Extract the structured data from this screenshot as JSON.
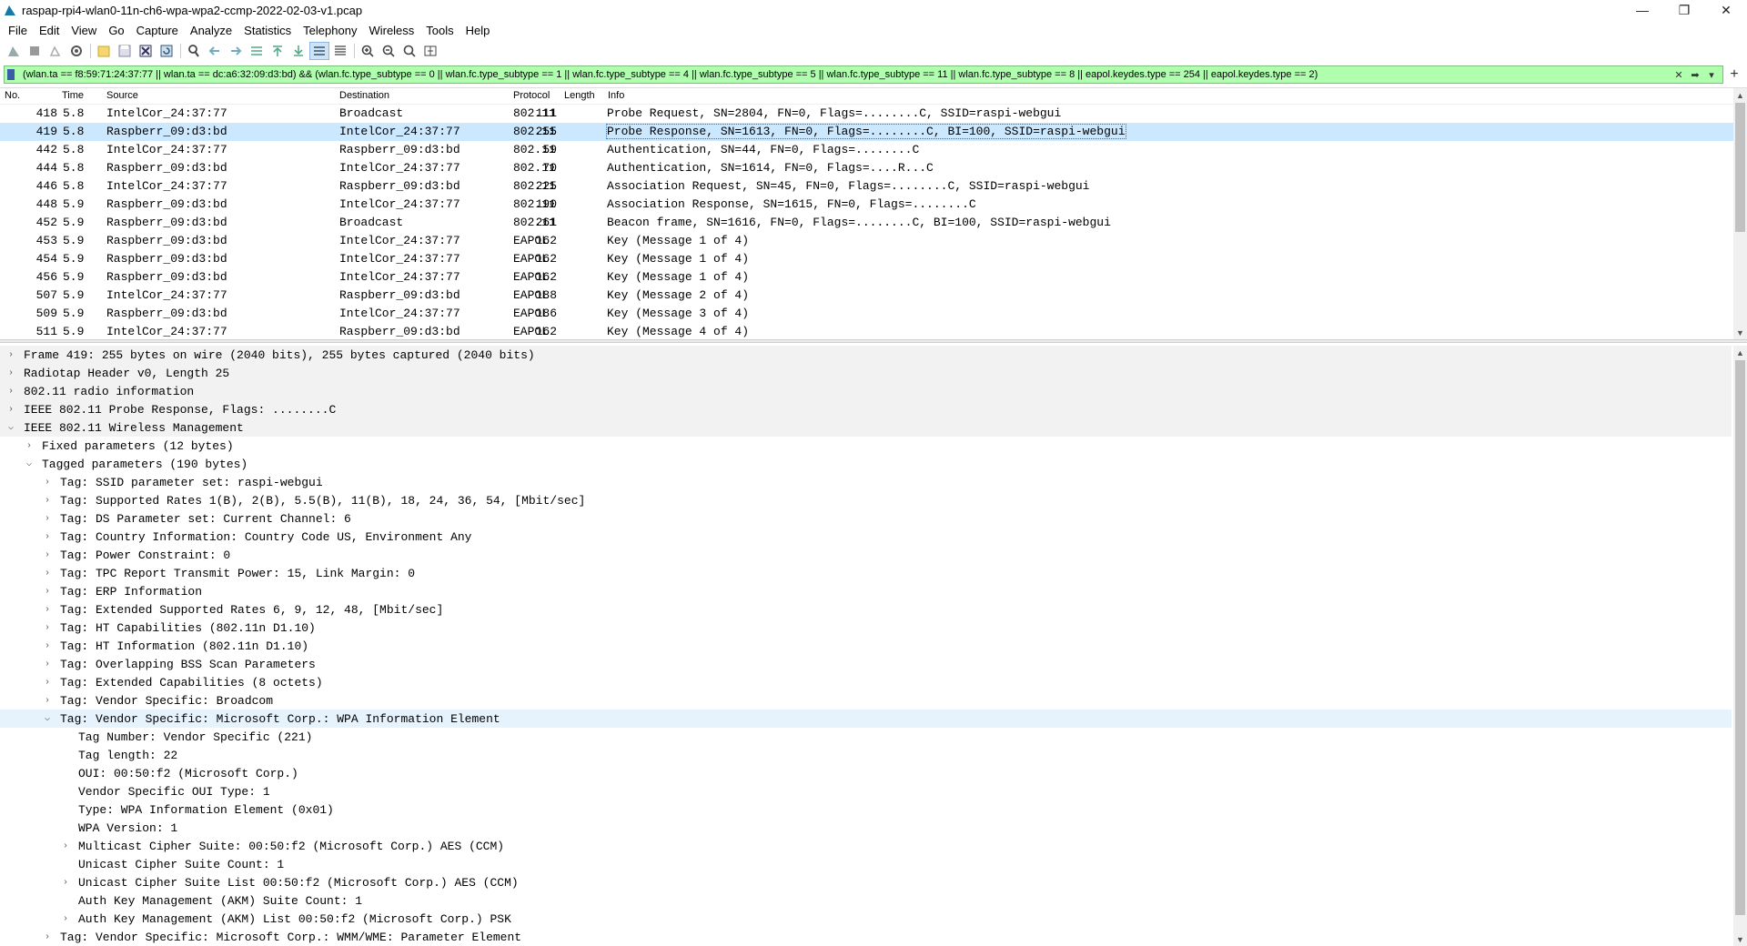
{
  "window": {
    "title": "raspap-rpi4-wlan0-11n-ch6-wpa-wpa2-ccmp-2022-02-03-v1.pcap",
    "minimize": "—",
    "maximize": "❐",
    "close": "✕"
  },
  "menu": [
    "File",
    "Edit",
    "View",
    "Go",
    "Capture",
    "Analyze",
    "Statistics",
    "Telephony",
    "Wireless",
    "Tools",
    "Help"
  ],
  "toolbar": {
    "icons": [
      "shark-fin-start-icon",
      "stop-capture-icon",
      "restart-capture-icon",
      "capture-options-icon",
      "open-file-icon",
      "save-file-icon",
      "close-file-icon",
      "reload-file-icon",
      "find-packet-icon",
      "go-back-icon",
      "go-forward-icon",
      "go-to-packet-icon",
      "go-first-icon",
      "go-last-icon",
      "autoscroll-icon",
      "colorize-icon",
      "zoom-in-icon",
      "zoom-out-icon",
      "zoom-normal-icon",
      "resize-columns-icon"
    ]
  },
  "filter": {
    "text": "(wlan.ta == f8:59:71:24:37:77 || wlan.ta == dc:a6:32:09:d3:bd) && (wlan.fc.type_subtype == 0 || wlan.fc.type_subtype == 1 || wlan.fc.type_subtype == 4 || wlan.fc.type_subtype == 5 || wlan.fc.type_subtype == 11  || wlan.fc.type_subtype == 8 || eapol.keydes.type == 254 || eapol.keydes.type == 2)",
    "background": "#afffaf"
  },
  "packet_list": {
    "columns": {
      "no": "No.",
      "time": "Time",
      "source": "Source",
      "destination": "Destination",
      "protocol": "Protocol",
      "length": "Length",
      "info": "Info"
    },
    "selected_no": "419",
    "rows": [
      {
        "no": "418",
        "time": "5.8",
        "source": "IntelCor_24:37:77",
        "destination": "Broadcast",
        "protocol": "802.11",
        "length": "111",
        "info": "Probe Request, SN=2804, FN=0, Flags=........C, SSID=raspi-webgui"
      },
      {
        "no": "419",
        "time": "5.8",
        "source": "Raspberr_09:d3:bd",
        "destination": "IntelCor_24:37:77",
        "protocol": "802.11",
        "length": "255",
        "info": "Probe Response, SN=1613, FN=0, Flags=........C, BI=100, SSID=raspi-webgui"
      },
      {
        "no": "442",
        "time": "5.8",
        "source": "IntelCor_24:37:77",
        "destination": "Raspberr_09:d3:bd",
        "protocol": "802.11",
        "length": "59",
        "info": "Authentication, SN=44, FN=0, Flags=........C"
      },
      {
        "no": "444",
        "time": "5.8",
        "source": "Raspberr_09:d3:bd",
        "destination": "IntelCor_24:37:77",
        "protocol": "802.11",
        "length": "70",
        "info": "Authentication, SN=1614, FN=0, Flags=....R...C"
      },
      {
        "no": "446",
        "time": "5.8",
        "source": "IntelCor_24:37:77",
        "destination": "Raspberr_09:d3:bd",
        "protocol": "802.11",
        "length": "225",
        "info": "Association Request, SN=45, FN=0, Flags=........C, SSID=raspi-webgui"
      },
      {
        "no": "448",
        "time": "5.9",
        "source": "Raspberr_09:d3:bd",
        "destination": "IntelCor_24:37:77",
        "protocol": "802.11",
        "length": "190",
        "info": "Association Response, SN=1615, FN=0, Flags=........C"
      },
      {
        "no": "452",
        "time": "5.9",
        "source": "Raspberr_09:d3:bd",
        "destination": "Broadcast",
        "protocol": "802.11",
        "length": "261",
        "info": "Beacon frame, SN=1616, FN=0, Flags=........C, BI=100, SSID=raspi-webgui"
      },
      {
        "no": "453",
        "time": "5.9",
        "source": "Raspberr_09:d3:bd",
        "destination": "IntelCor_24:37:77",
        "protocol": "EAPOL",
        "length": "162",
        "info": "Key (Message 1 of 4)"
      },
      {
        "no": "454",
        "time": "5.9",
        "source": "Raspberr_09:d3:bd",
        "destination": "IntelCor_24:37:77",
        "protocol": "EAPOL",
        "length": "162",
        "info": "Key (Message 1 of 4)"
      },
      {
        "no": "456",
        "time": "5.9",
        "source": "Raspberr_09:d3:bd",
        "destination": "IntelCor_24:37:77",
        "protocol": "EAPOL",
        "length": "162",
        "info": "Key (Message 1 of 4)"
      },
      {
        "no": "507",
        "time": "5.9",
        "source": "IntelCor_24:37:77",
        "destination": "Raspberr_09:d3:bd",
        "protocol": "EAPOL",
        "length": "188",
        "info": "Key (Message 2 of 4)"
      },
      {
        "no": "509",
        "time": "5.9",
        "source": "Raspberr_09:d3:bd",
        "destination": "IntelCor_24:37:77",
        "protocol": "EAPOL",
        "length": "186",
        "info": "Key (Message 3 of 4)"
      },
      {
        "no": "511",
        "time": "5.9",
        "source": "IntelCor_24:37:77",
        "destination": "Raspberr_09:d3:bd",
        "protocol": "EAPOL",
        "length": "162",
        "info": "Key (Message 4 of 4)"
      }
    ]
  },
  "details": {
    "rows": [
      {
        "level": 0,
        "state": "collapsed",
        "text": "Frame 419: 255 bytes on wire (2040 bits), 255 bytes captured (2040 bits)",
        "style": "gray"
      },
      {
        "level": 0,
        "state": "collapsed",
        "text": "Radiotap Header v0, Length 25",
        "style": "gray"
      },
      {
        "level": 0,
        "state": "collapsed",
        "text": "802.11 radio information",
        "style": "gray"
      },
      {
        "level": 0,
        "state": "collapsed",
        "text": "IEEE 802.11 Probe Response, Flags: ........C",
        "style": "gray"
      },
      {
        "level": 0,
        "state": "expanded",
        "text": "IEEE 802.11 Wireless Management",
        "style": "gray"
      },
      {
        "level": 1,
        "state": "collapsed",
        "text": "Fixed parameters (12 bytes)",
        "style": ""
      },
      {
        "level": 1,
        "state": "expanded",
        "text": "Tagged parameters (190 bytes)",
        "style": ""
      },
      {
        "level": 2,
        "state": "collapsed",
        "text": "Tag: SSID parameter set: raspi-webgui",
        "style": ""
      },
      {
        "level": 2,
        "state": "collapsed",
        "text": "Tag: Supported Rates 1(B), 2(B), 5.5(B), 11(B), 18, 24, 36, 54, [Mbit/sec]",
        "style": ""
      },
      {
        "level": 2,
        "state": "collapsed",
        "text": "Tag: DS Parameter set: Current Channel: 6",
        "style": ""
      },
      {
        "level": 2,
        "state": "collapsed",
        "text": "Tag: Country Information: Country Code US, Environment Any",
        "style": ""
      },
      {
        "level": 2,
        "state": "collapsed",
        "text": "Tag: Power Constraint: 0",
        "style": ""
      },
      {
        "level": 2,
        "state": "collapsed",
        "text": "Tag: TPC Report Transmit Power: 15, Link Margin: 0",
        "style": ""
      },
      {
        "level": 2,
        "state": "collapsed",
        "text": "Tag: ERP Information",
        "style": ""
      },
      {
        "level": 2,
        "state": "collapsed",
        "text": "Tag: Extended Supported Rates 6, 9, 12, 48, [Mbit/sec]",
        "style": ""
      },
      {
        "level": 2,
        "state": "collapsed",
        "text": "Tag: HT Capabilities (802.11n D1.10)",
        "style": ""
      },
      {
        "level": 2,
        "state": "collapsed",
        "text": "Tag: HT Information (802.11n D1.10)",
        "style": ""
      },
      {
        "level": 2,
        "state": "collapsed",
        "text": "Tag: Overlapping BSS Scan Parameters",
        "style": ""
      },
      {
        "level": 2,
        "state": "collapsed",
        "text": "Tag: Extended Capabilities (8 octets)",
        "style": ""
      },
      {
        "level": 2,
        "state": "collapsed",
        "text": "Tag: Vendor Specific: Broadcom",
        "style": ""
      },
      {
        "level": 2,
        "state": "expanded",
        "text": "Tag: Vendor Specific: Microsoft Corp.: WPA Information Element",
        "style": "hl"
      },
      {
        "level": 3,
        "state": "leaf",
        "text": "Tag Number: Vendor Specific (221)",
        "style": ""
      },
      {
        "level": 3,
        "state": "leaf",
        "text": "Tag length: 22",
        "style": ""
      },
      {
        "level": 3,
        "state": "leaf",
        "text": "OUI: 00:50:f2 (Microsoft Corp.)",
        "style": ""
      },
      {
        "level": 3,
        "state": "leaf",
        "text": "Vendor Specific OUI Type: 1",
        "style": ""
      },
      {
        "level": 3,
        "state": "leaf",
        "text": "Type: WPA Information Element (0x01)",
        "style": ""
      },
      {
        "level": 3,
        "state": "leaf",
        "text": "WPA Version: 1",
        "style": ""
      },
      {
        "level": 3,
        "state": "collapsed",
        "text": "Multicast Cipher Suite: 00:50:f2 (Microsoft Corp.) AES (CCM)",
        "style": ""
      },
      {
        "level": 3,
        "state": "leaf",
        "text": "Unicast Cipher Suite Count: 1",
        "style": ""
      },
      {
        "level": 3,
        "state": "collapsed",
        "text": "Unicast Cipher Suite List 00:50:f2 (Microsoft Corp.) AES (CCM)",
        "style": ""
      },
      {
        "level": 3,
        "state": "leaf",
        "text": "Auth Key Management (AKM) Suite Count: 1",
        "style": ""
      },
      {
        "level": 3,
        "state": "collapsed",
        "text": "Auth Key Management (AKM) List 00:50:f2 (Microsoft Corp.) PSK",
        "style": ""
      },
      {
        "level": 2,
        "state": "collapsed",
        "text": "Tag: Vendor Specific: Microsoft Corp.: WMM/WME: Parameter Element",
        "style": ""
      }
    ]
  }
}
